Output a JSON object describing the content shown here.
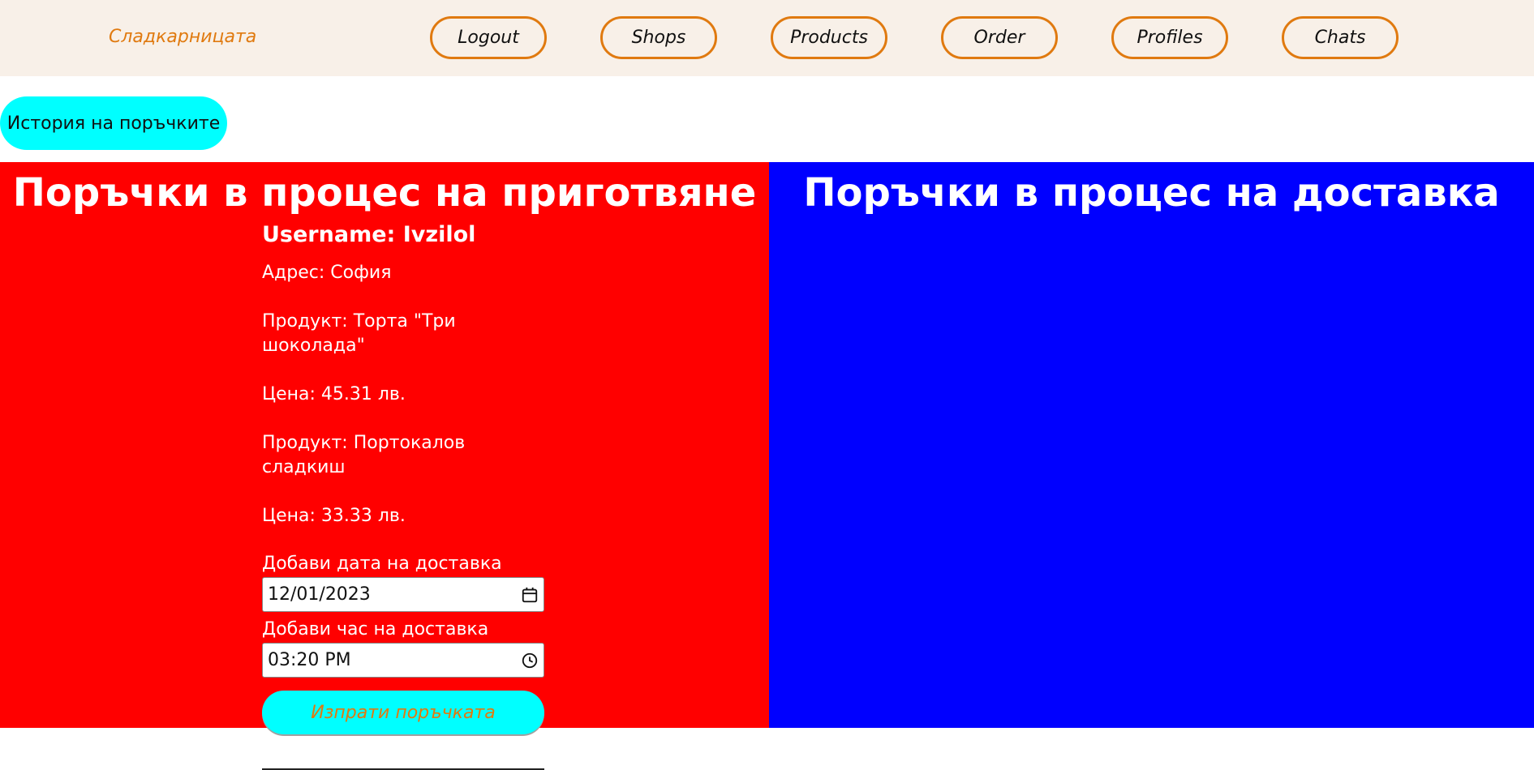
{
  "navbar": {
    "brand": "Сладкарницата",
    "links": [
      "Logout",
      "Shops",
      "Products",
      "Order",
      "Profiles",
      "Chats"
    ]
  },
  "history_button": "История на поръчките",
  "left_panel": {
    "title": "Поръчки в процес на приготвяне",
    "order": {
      "username": "Username: Ivzilol",
      "address": "Адрес: София",
      "items": [
        {
          "product": "Продукт: Торта \"Три шоколада\"",
          "price": "Цена: 45.31 лв."
        },
        {
          "product": "Продукт: Портокалов сладкиш",
          "price": "Цена: 33.33 лв."
        }
      ],
      "date_label": "Добави дата на доставка",
      "date_value": "12/01/2023",
      "time_label": "Добави час на доставка",
      "time_value": "03:20 PM",
      "submit_label": "Изпрати поръчката"
    }
  },
  "right_panel": {
    "title": "Поръчки в процес на доставка"
  },
  "colors": {
    "accent": "#e07a10",
    "nav_bg": "#f8f0e8",
    "cyan": "#00ffff",
    "left_bg": "#ff0000",
    "right_bg": "#0000ff"
  },
  "icons": [
    "calendar-icon",
    "clock-icon"
  ]
}
